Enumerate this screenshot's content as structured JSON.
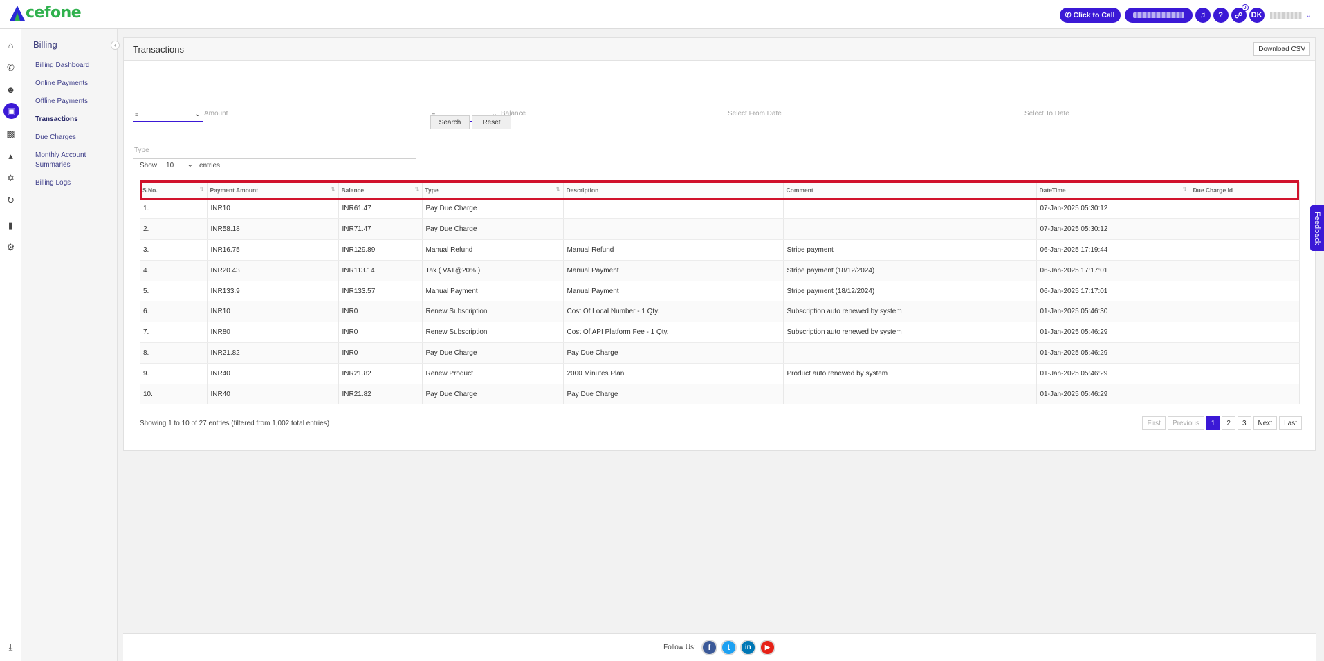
{
  "brand": {
    "logo_text": "cefone"
  },
  "topbar": {
    "click_to_call": "Click to Call",
    "help": "?",
    "notif_count": "0",
    "user_initials": "DK"
  },
  "sidebar": {
    "title": "Billing",
    "items": [
      {
        "label": "Billing Dashboard"
      },
      {
        "label": "Online Payments"
      },
      {
        "label": "Offline Payments"
      },
      {
        "label": "Transactions"
      },
      {
        "label": "Due Charges"
      },
      {
        "label": "Monthly Account Summaries"
      },
      {
        "label": "Billing Logs"
      }
    ]
  },
  "page": {
    "title": "Transactions",
    "download_csv": "Download CSV"
  },
  "filters": {
    "amount_operator": "=",
    "amount_placeholder": "Amount",
    "balance_operator": "=",
    "balance_placeholder": "Balance",
    "from_date_placeholder": "Select From Date",
    "to_date_placeholder": "Select To Date",
    "type_placeholder": "Type",
    "search": "Search",
    "reset": "Reset"
  },
  "length": {
    "show": "Show",
    "value": "10",
    "entries": "entries"
  },
  "table": {
    "columns": [
      "S.No.",
      "Payment Amount",
      "Balance",
      "Type",
      "Description",
      "Comment",
      "DateTime",
      "Due Charge Id"
    ],
    "rows": [
      [
        "1.",
        "INR10",
        "INR61.47",
        "Pay Due Charge",
        "",
        "",
        "07-Jan-2025 05:30:12",
        ""
      ],
      [
        "2.",
        "INR58.18",
        "INR71.47",
        "Pay Due Charge",
        "",
        "",
        "07-Jan-2025 05:30:12",
        ""
      ],
      [
        "3.",
        "INR16.75",
        "INR129.89",
        "Manual Refund",
        "Manual Refund",
        "Stripe payment",
        "06-Jan-2025 17:19:44",
        ""
      ],
      [
        "4.",
        "INR20.43",
        "INR113.14",
        "Tax ( VAT@20% )",
        "Manual Payment",
        "Stripe payment (18/12/2024)",
        "06-Jan-2025 17:17:01",
        ""
      ],
      [
        "5.",
        "INR133.9",
        "INR133.57",
        "Manual Payment",
        "Manual Payment",
        "Stripe payment (18/12/2024)",
        "06-Jan-2025 17:17:01",
        ""
      ],
      [
        "6.",
        "INR10",
        "INR0",
        "Renew Subscription",
        "Cost Of Local Number - 1 Qty.",
        "Subscription auto renewed by system",
        "01-Jan-2025 05:46:30",
        ""
      ],
      [
        "7.",
        "INR80",
        "INR0",
        "Renew Subscription",
        "Cost Of API Platform Fee - 1 Qty.",
        "Subscription auto renewed by system",
        "01-Jan-2025 05:46:29",
        ""
      ],
      [
        "8.",
        "INR21.82",
        "INR0",
        "Pay Due Charge",
        "Pay Due Charge",
        "",
        "01-Jan-2025 05:46:29",
        ""
      ],
      [
        "9.",
        "INR40",
        "INR21.82",
        "Renew Product",
        "2000 Minutes Plan",
        "Product auto renewed by system",
        "01-Jan-2025 05:46:29",
        ""
      ],
      [
        "10.",
        "INR40",
        "INR21.82",
        "Pay Due Charge",
        "Pay Due Charge",
        "",
        "01-Jan-2025 05:46:29",
        ""
      ]
    ]
  },
  "info": "Showing 1 to 10 of 27 entries (filtered from 1,002 total entries)",
  "pagination": {
    "first": "First",
    "previous": "Previous",
    "pages": [
      "1",
      "2",
      "3"
    ],
    "current": "1",
    "next": "Next",
    "last": "Last"
  },
  "footer": {
    "follow": "Follow Us:",
    "social": [
      "f",
      "t",
      "in",
      "▶"
    ]
  },
  "feedback": "Feedback",
  "colors": {
    "accent": "#3b19d6",
    "brand_green": "#2fb14d",
    "highlight": "#d0112b"
  }
}
